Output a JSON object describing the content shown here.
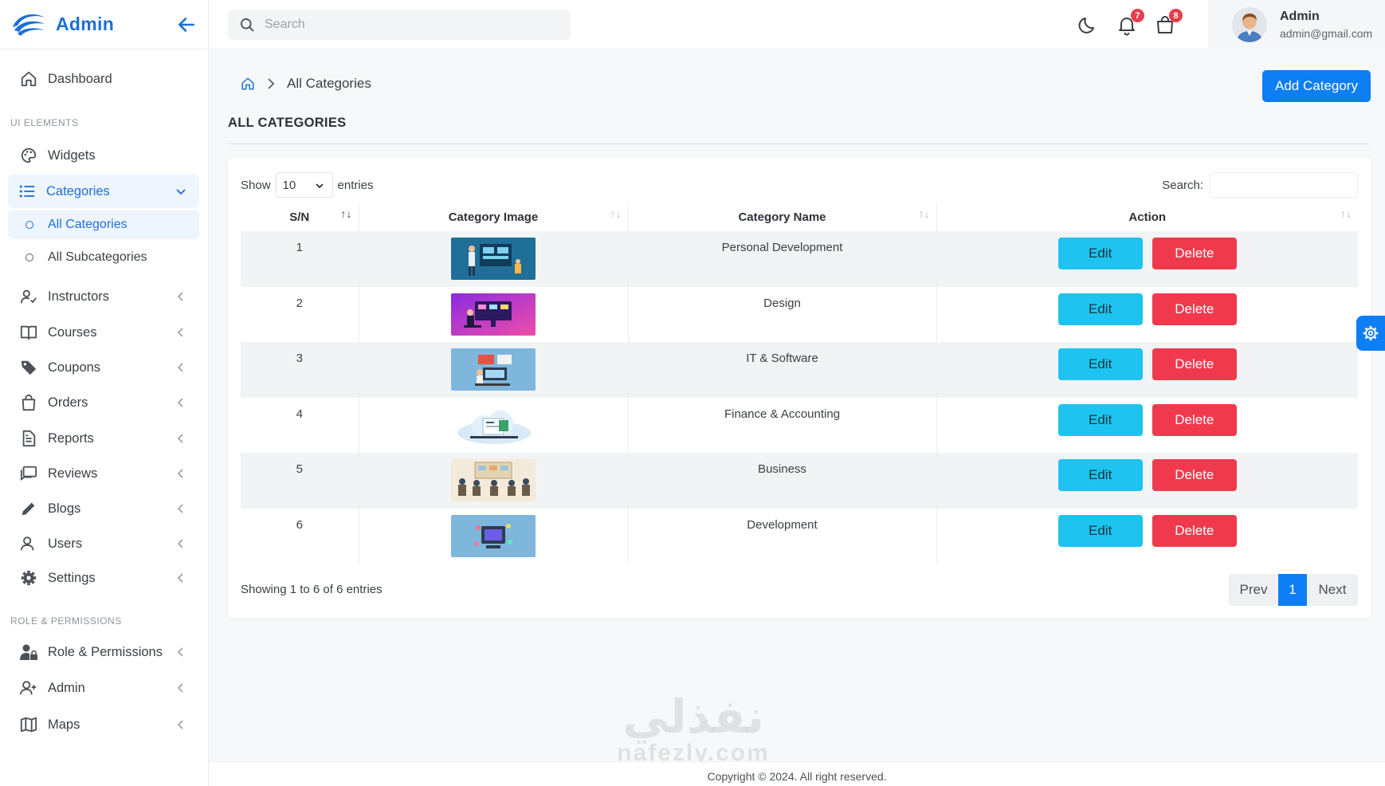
{
  "brand": {
    "title": "Admin"
  },
  "sidebar": {
    "dashboard": "Dashboard",
    "section_ui": "UI ELEMENTS",
    "widgets": "Widgets",
    "categories": "Categories",
    "sub": [
      "All Categories",
      "All Subcategories"
    ],
    "items": [
      "Instructors",
      "Courses",
      "Coupons",
      "Orders",
      "Reports",
      "Reviews",
      "Blogs",
      "Users",
      "Settings"
    ],
    "section_role": "ROLE & PERMISSIONS",
    "role_items": [
      "Role & Permissions",
      "Admin",
      "Maps"
    ]
  },
  "header": {
    "search_placeholder": "Search",
    "notif_count": "7",
    "cart_count": "8",
    "user_name": "Admin",
    "user_email": "admin@gmail.com"
  },
  "breadcrumb": {
    "current": "All Categories"
  },
  "add_button": "Add Category",
  "page_title": "ALL CATEGORIES",
  "table_controls": {
    "show_label": "Show",
    "page_length": "10",
    "entries_label": "entries",
    "search_label": "Search:"
  },
  "table": {
    "headers": [
      "S/N",
      "Category Image",
      "Category Name",
      "Action"
    ],
    "rows": [
      {
        "sn": "1",
        "name": "Personal Development",
        "image": "personal-development-illustration"
      },
      {
        "sn": "2",
        "name": "Design",
        "image": "design-illustration"
      },
      {
        "sn": "3",
        "name": "IT & Software",
        "image": "it-software-illustration"
      },
      {
        "sn": "4",
        "name": "Finance & Accounting",
        "image": "finance-accounting-illustration"
      },
      {
        "sn": "5",
        "name": "Business",
        "image": "business-illustration"
      },
      {
        "sn": "6",
        "name": "Development",
        "image": "development-illustration"
      }
    ],
    "edit_label": "Edit",
    "delete_label": "Delete"
  },
  "info": "Showing 1 to 6 of 6 entries",
  "pagination": {
    "prev": "Prev",
    "current": "1",
    "next": "Next"
  },
  "footer": "Copyright © 2024. All right reserved.",
  "watermark": {
    "arabic": "نفذلي",
    "latin": "nafezly.com"
  },
  "colors": {
    "primary": "#0d7ef3",
    "edit": "#1ec4ef",
    "delete": "#f0394c",
    "badge": "#e83d4a"
  }
}
